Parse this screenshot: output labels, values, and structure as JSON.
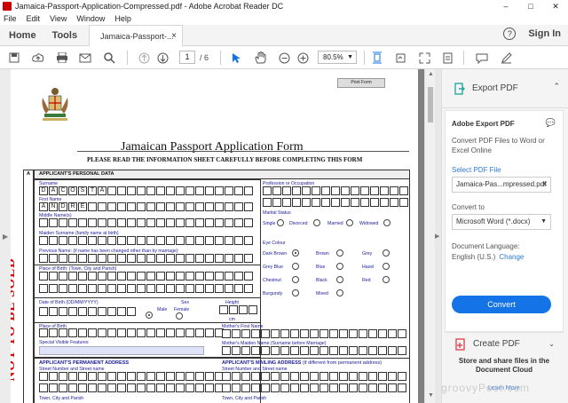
{
  "window": {
    "title": "Jamaica-Passport-Application-Compressed.pdf - Adobe Acrobat Reader DC",
    "min": "–",
    "max": "□",
    "close": "✕"
  },
  "menu": [
    "File",
    "Edit",
    "View",
    "Window",
    "Help"
  ],
  "tabs": {
    "home": "Home",
    "tools": "Tools",
    "doc": "Jamaica-Passport-...",
    "close": "×",
    "help": "?",
    "signin": "Sign In"
  },
  "toolbar": {
    "page": "1",
    "total": "/ 6",
    "zoom": "80.5%"
  },
  "panel": {
    "export_header": "Export PDF",
    "card_title": "Adobe Export PDF",
    "desc": "Convert PDF Files to Word or Excel Online",
    "select_label": "Select PDF File",
    "file_name": "Jamaica-Pas...mpressed.pdf",
    "convert_to": "Convert to",
    "format": "Microsoft Word (*.docx)",
    "doc_lang_label": "Document Language:",
    "doc_lang": "English (U.S.)",
    "change": "Change",
    "convert_button": "Convert",
    "create_pdf": "Create PDF",
    "store": "Store and share files in the Document Cloud",
    "learn": "Learn More"
  },
  "watermark": "groovyPost.com",
  "form": {
    "print": "Print Form",
    "title": "Jamaican Passport Application Form",
    "subtitle": "PLEASE READ THE INFORMATION SHEET CAREFULLY BEFORE COMPLETING THIS FORM",
    "section_a": "A",
    "section_title": "APPLICANT'S PERSONAL DATA",
    "surname": "Surname",
    "surname_value": [
      "D",
      "A",
      "C",
      "O",
      "S",
      "T",
      "A"
    ],
    "first": "First Name",
    "first_value": [
      "A",
      "N",
      "D",
      "R",
      "E"
    ],
    "middle": "Middle Name(s)",
    "maiden": "Maiden Surname (family name at birth)",
    "previous": "Previous Name: (if name has been changed other than by marriage)",
    "pob": "Place of Birth: (Town, City and Parish)",
    "dob": "Date of Birth (DD/MM/YYYY)",
    "sex": "Sex",
    "male": "Male",
    "female": "Female",
    "height": "Height",
    "cm": "cm",
    "pob2": "Place of Birth",
    "features": "Special Visible Features",
    "profession": "Profession or Occupation",
    "marital": "Marital Status",
    "single": "Single",
    "divorced": "Divorced",
    "married": "Married",
    "widowed": "Widowed",
    "eye": "Eye Colour",
    "eyes": [
      [
        "Dark Brown",
        "Brown",
        "Grey"
      ],
      [
        "Grey Blue",
        "Blue",
        "Hazel"
      ],
      [
        "Chestnut",
        "Black",
        "Red"
      ],
      [
        "Burgundy",
        "Mixed",
        ""
      ]
    ],
    "mother": "Mother's First Name",
    "mother_maiden": "Mother's Maiden Name (Surname before Marriage)",
    "perm": "APPLICANT'S PERMANENT ADDRESS",
    "street": "Street Number and Street name",
    "mailing": "APPLICANT'S MAILING ADDRESS",
    "mailing_note": "(if different from permanent address)",
    "street2": "Street Number and Street name",
    "town": "Town, City and Parish",
    "town2": "Town, City and Parish",
    "stamp": "NOT TO BE SOLD"
  }
}
